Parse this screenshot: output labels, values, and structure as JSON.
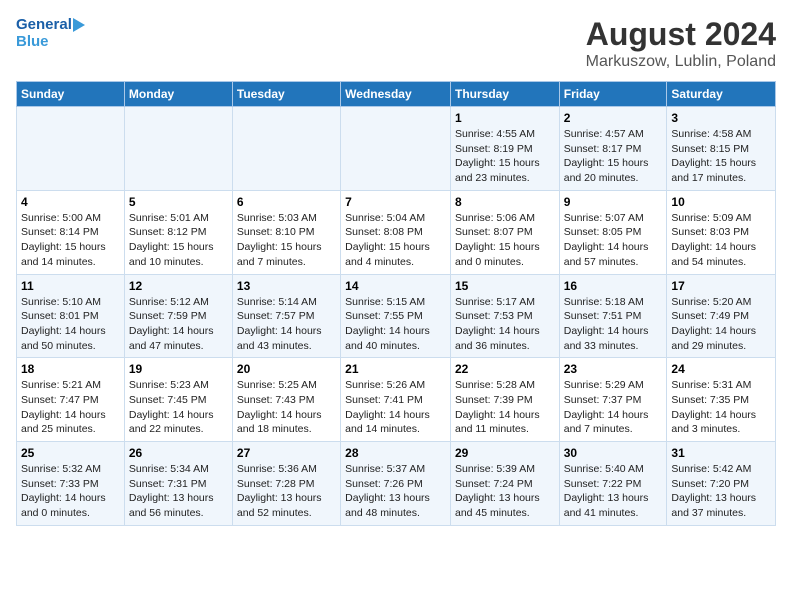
{
  "logo": {
    "line1": "General",
    "line2": "Blue"
  },
  "title": "August 2024",
  "subtitle": "Markuszow, Lublin, Poland",
  "days_of_week": [
    "Sunday",
    "Monday",
    "Tuesday",
    "Wednesday",
    "Thursday",
    "Friday",
    "Saturday"
  ],
  "weeks": [
    [
      {
        "day": "",
        "text": ""
      },
      {
        "day": "",
        "text": ""
      },
      {
        "day": "",
        "text": ""
      },
      {
        "day": "",
        "text": ""
      },
      {
        "day": "1",
        "text": "Sunrise: 4:55 AM\nSunset: 8:19 PM\nDaylight: 15 hours\nand 23 minutes."
      },
      {
        "day": "2",
        "text": "Sunrise: 4:57 AM\nSunset: 8:17 PM\nDaylight: 15 hours\nand 20 minutes."
      },
      {
        "day": "3",
        "text": "Sunrise: 4:58 AM\nSunset: 8:15 PM\nDaylight: 15 hours\nand 17 minutes."
      }
    ],
    [
      {
        "day": "4",
        "text": "Sunrise: 5:00 AM\nSunset: 8:14 PM\nDaylight: 15 hours\nand 14 minutes."
      },
      {
        "day": "5",
        "text": "Sunrise: 5:01 AM\nSunset: 8:12 PM\nDaylight: 15 hours\nand 10 minutes."
      },
      {
        "day": "6",
        "text": "Sunrise: 5:03 AM\nSunset: 8:10 PM\nDaylight: 15 hours\nand 7 minutes."
      },
      {
        "day": "7",
        "text": "Sunrise: 5:04 AM\nSunset: 8:08 PM\nDaylight: 15 hours\nand 4 minutes."
      },
      {
        "day": "8",
        "text": "Sunrise: 5:06 AM\nSunset: 8:07 PM\nDaylight: 15 hours\nand 0 minutes."
      },
      {
        "day": "9",
        "text": "Sunrise: 5:07 AM\nSunset: 8:05 PM\nDaylight: 14 hours\nand 57 minutes."
      },
      {
        "day": "10",
        "text": "Sunrise: 5:09 AM\nSunset: 8:03 PM\nDaylight: 14 hours\nand 54 minutes."
      }
    ],
    [
      {
        "day": "11",
        "text": "Sunrise: 5:10 AM\nSunset: 8:01 PM\nDaylight: 14 hours\nand 50 minutes."
      },
      {
        "day": "12",
        "text": "Sunrise: 5:12 AM\nSunset: 7:59 PM\nDaylight: 14 hours\nand 47 minutes."
      },
      {
        "day": "13",
        "text": "Sunrise: 5:14 AM\nSunset: 7:57 PM\nDaylight: 14 hours\nand 43 minutes."
      },
      {
        "day": "14",
        "text": "Sunrise: 5:15 AM\nSunset: 7:55 PM\nDaylight: 14 hours\nand 40 minutes."
      },
      {
        "day": "15",
        "text": "Sunrise: 5:17 AM\nSunset: 7:53 PM\nDaylight: 14 hours\nand 36 minutes."
      },
      {
        "day": "16",
        "text": "Sunrise: 5:18 AM\nSunset: 7:51 PM\nDaylight: 14 hours\nand 33 minutes."
      },
      {
        "day": "17",
        "text": "Sunrise: 5:20 AM\nSunset: 7:49 PM\nDaylight: 14 hours\nand 29 minutes."
      }
    ],
    [
      {
        "day": "18",
        "text": "Sunrise: 5:21 AM\nSunset: 7:47 PM\nDaylight: 14 hours\nand 25 minutes."
      },
      {
        "day": "19",
        "text": "Sunrise: 5:23 AM\nSunset: 7:45 PM\nDaylight: 14 hours\nand 22 minutes."
      },
      {
        "day": "20",
        "text": "Sunrise: 5:25 AM\nSunset: 7:43 PM\nDaylight: 14 hours\nand 18 minutes."
      },
      {
        "day": "21",
        "text": "Sunrise: 5:26 AM\nSunset: 7:41 PM\nDaylight: 14 hours\nand 14 minutes."
      },
      {
        "day": "22",
        "text": "Sunrise: 5:28 AM\nSunset: 7:39 PM\nDaylight: 14 hours\nand 11 minutes."
      },
      {
        "day": "23",
        "text": "Sunrise: 5:29 AM\nSunset: 7:37 PM\nDaylight: 14 hours\nand 7 minutes."
      },
      {
        "day": "24",
        "text": "Sunrise: 5:31 AM\nSunset: 7:35 PM\nDaylight: 14 hours\nand 3 minutes."
      }
    ],
    [
      {
        "day": "25",
        "text": "Sunrise: 5:32 AM\nSunset: 7:33 PM\nDaylight: 14 hours\nand 0 minutes."
      },
      {
        "day": "26",
        "text": "Sunrise: 5:34 AM\nSunset: 7:31 PM\nDaylight: 13 hours\nand 56 minutes."
      },
      {
        "day": "27",
        "text": "Sunrise: 5:36 AM\nSunset: 7:28 PM\nDaylight: 13 hours\nand 52 minutes."
      },
      {
        "day": "28",
        "text": "Sunrise: 5:37 AM\nSunset: 7:26 PM\nDaylight: 13 hours\nand 48 minutes."
      },
      {
        "day": "29",
        "text": "Sunrise: 5:39 AM\nSunset: 7:24 PM\nDaylight: 13 hours\nand 45 minutes."
      },
      {
        "day": "30",
        "text": "Sunrise: 5:40 AM\nSunset: 7:22 PM\nDaylight: 13 hours\nand 41 minutes."
      },
      {
        "day": "31",
        "text": "Sunrise: 5:42 AM\nSunset: 7:20 PM\nDaylight: 13 hours\nand 37 minutes."
      }
    ]
  ]
}
